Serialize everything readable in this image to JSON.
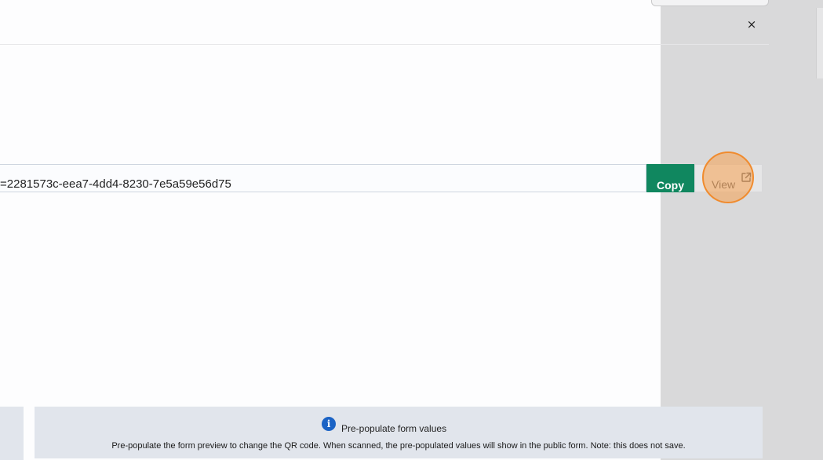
{
  "modal": {
    "close_label": "×"
  },
  "share": {
    "url_value": "=2281573c-eea7-4dd4-8230-7e5a59e56d75",
    "copy_label": "Copy",
    "view_label": "View",
    "view_icon": "external-link-icon"
  },
  "prepopulate": {
    "icon": "info-icon",
    "icon_glyph": "i",
    "title": "Pre-populate form values",
    "description": "Pre-populate the form preview to change the QR code. When scanned, the pre-populated values will show in the public form. Note: this does not save."
  },
  "colors": {
    "copy_button": "#10875f",
    "info_icon": "#1b63c5",
    "highlight": "#f08b2e"
  }
}
